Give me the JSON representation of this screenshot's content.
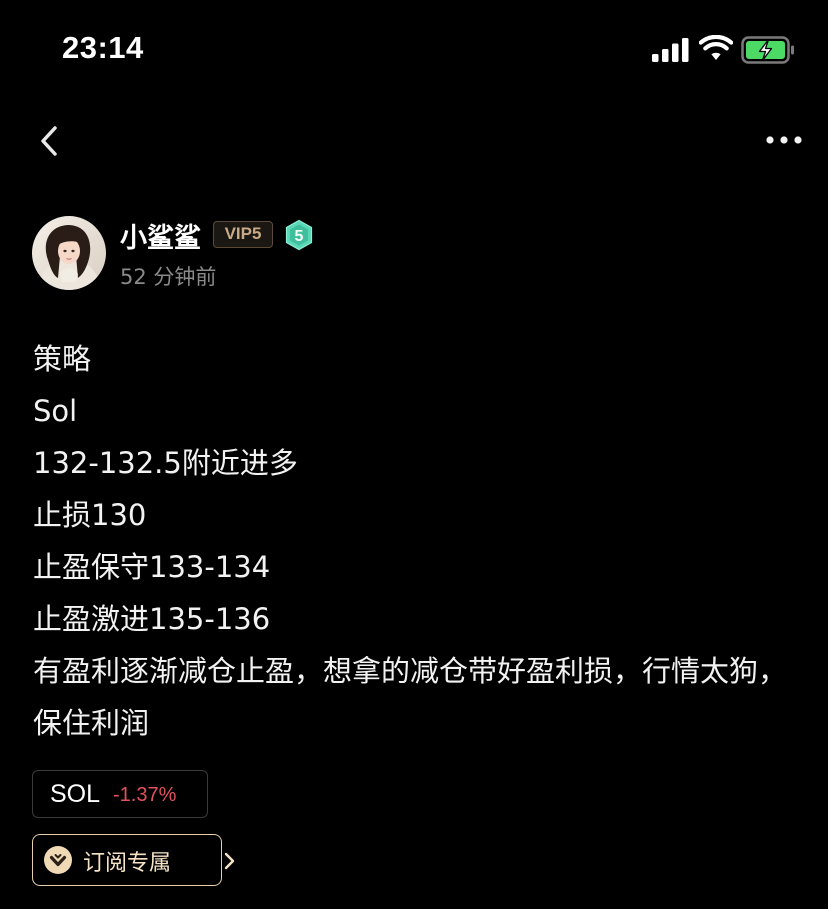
{
  "status_bar": {
    "time": "23:14",
    "icons": [
      "signal-icon",
      "wifi-icon",
      "battery-charging-icon"
    ],
    "battery_color": "#4cd964"
  },
  "nav": {
    "back_icon": "chevron-left-icon",
    "more_icon": "more-horizontal-icon"
  },
  "author": {
    "name": "小鲨鲨",
    "vip_badge": "VIP5",
    "level": "5",
    "level_color": "#55d6b4",
    "time_ago": "52 分钟前"
  },
  "post": {
    "lines": [
      "策略",
      "Sol",
      "132-132.5附近进多",
      "止损130",
      "止盈保守133-134",
      "止盈激进135-136",
      "有盈利逐渐减仓止盈，想拿的减仓带好盈利损，行情太狗，保住利润"
    ]
  },
  "ticker": {
    "symbol": "SOL",
    "change": "-1.37%",
    "change_color": "#e0525d"
  },
  "subscription": {
    "label": "订阅专属",
    "icon": "crown-chevron-icon",
    "accent": "#f0d9b5"
  }
}
